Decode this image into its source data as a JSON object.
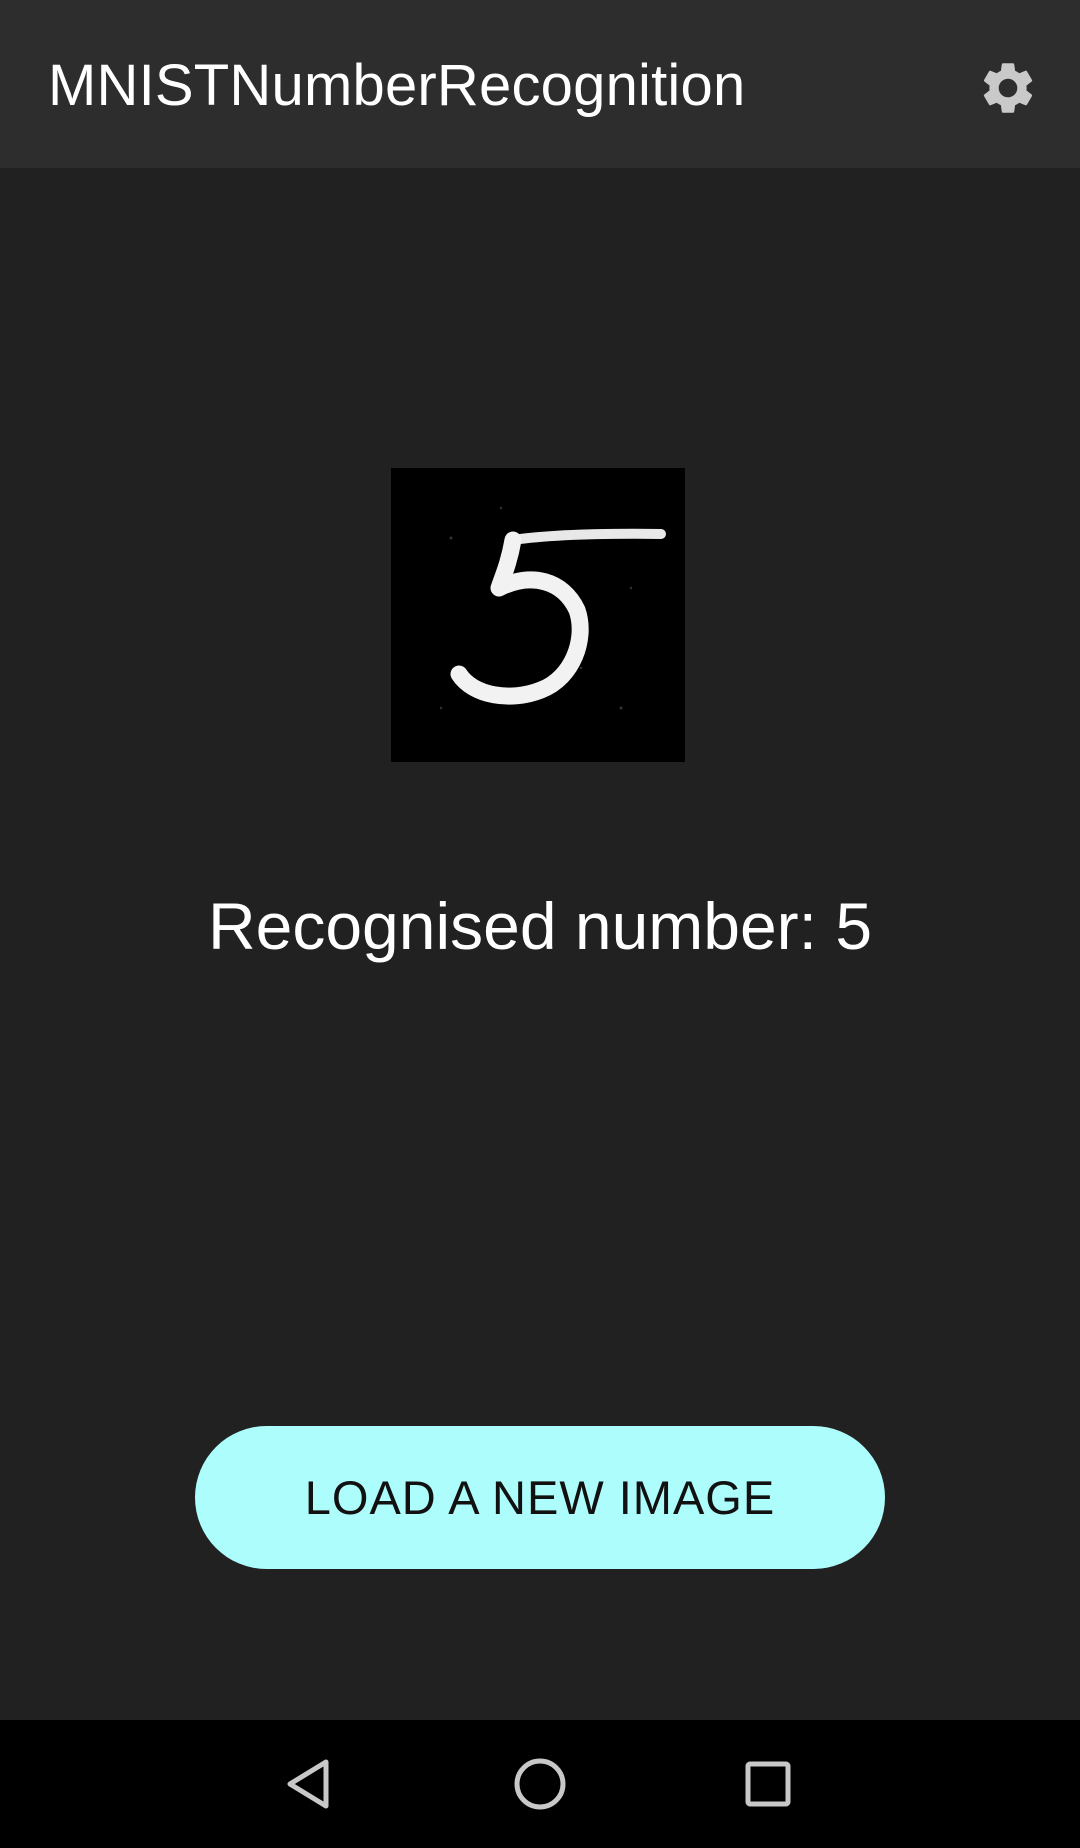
{
  "app_bar": {
    "title": "MNISTNumberRecognition",
    "settings_icon": "gear-icon"
  },
  "main": {
    "digit_image": {
      "alt": "handwritten digit"
    },
    "result_text": "Recognised number: 5",
    "load_button_label": "LOAD A NEW IMAGE"
  },
  "nav_bar": {
    "back_icon": "back-triangle-icon",
    "home_icon": "home-circle-icon",
    "recents_icon": "recents-square-icon"
  },
  "colors": {
    "background": "#212121",
    "app_bar": "#2d2d2d",
    "accent_button": "#adfdfd",
    "nav_bar": "#000000"
  }
}
